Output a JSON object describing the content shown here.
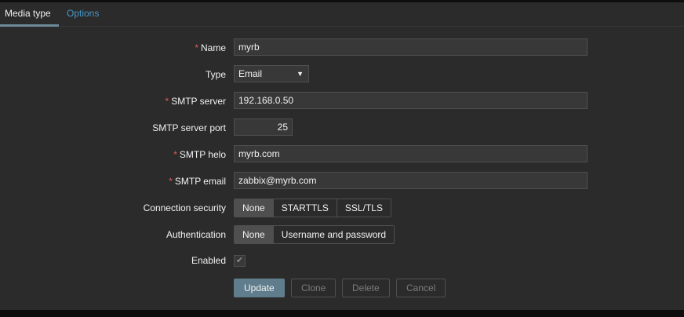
{
  "tabs": [
    {
      "label": "Media type"
    },
    {
      "label": "Options"
    }
  ],
  "form": {
    "name": {
      "label": "Name",
      "value": "myrb"
    },
    "type": {
      "label": "Type",
      "value": "Email"
    },
    "smtp_server": {
      "label": "SMTP server",
      "value": "192.168.0.50"
    },
    "smtp_port": {
      "label": "SMTP server port",
      "value": "25"
    },
    "smtp_helo": {
      "label": "SMTP helo",
      "value": "myrb.com"
    },
    "smtp_email": {
      "label": "SMTP email",
      "value": "zabbix@myrb.com"
    },
    "security": {
      "label": "Connection security",
      "options": [
        "None",
        "STARTTLS",
        "SSL/TLS"
      ],
      "selected": "None"
    },
    "auth": {
      "label": "Authentication",
      "options": [
        "None",
        "Username and password"
      ],
      "selected": "None"
    },
    "enabled": {
      "label": "Enabled",
      "checked": true
    }
  },
  "required_mark": "*",
  "buttons": {
    "update": "Update",
    "clone": "Clone",
    "delete": "Delete",
    "cancel": "Cancel"
  }
}
